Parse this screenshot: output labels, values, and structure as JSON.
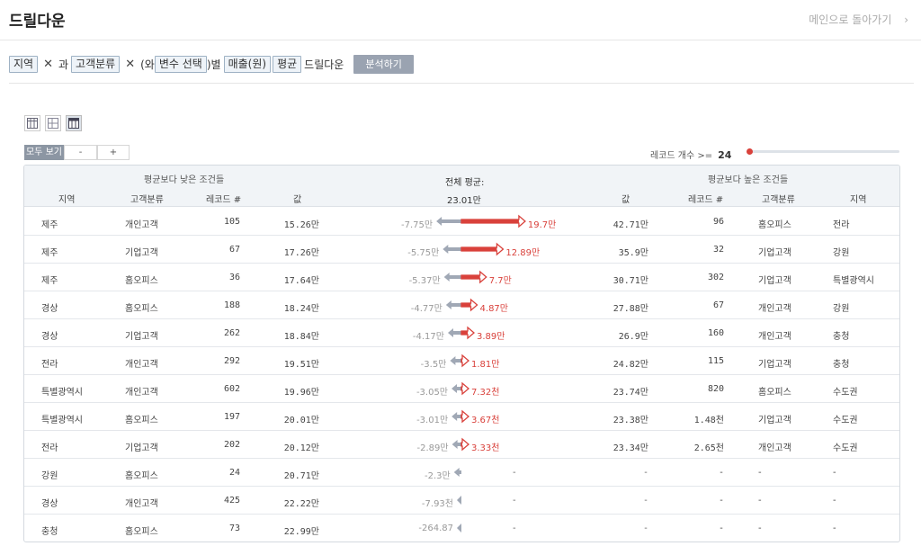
{
  "header": {
    "title": "드릴다운",
    "back_label": "메인으로 돌아가기"
  },
  "query": {
    "tag1": "지역",
    "join1": "과",
    "tag2": "고객분류",
    "open_paren": "(와",
    "tag3": "변수 선택",
    "byword": ")별",
    "tag4": "매출(원)",
    "tag5": "평균",
    "tail": "드릴다운",
    "analyze": "분석하기"
  },
  "toolbar": {
    "all": "모두 보기",
    "minus": "-",
    "plus": "+"
  },
  "record_filter": {
    "label": "레코드 개수 >=",
    "value": "24"
  },
  "table": {
    "left_group": "평균보다 낮은 조건들",
    "right_group": "평균보다 높은 조건들",
    "center_title": "전체 평균:",
    "center_value": "23.01만",
    "col_region": "지역",
    "col_segment": "고객분류",
    "col_records": "레코드 #",
    "col_value": "값",
    "rows": [
      {
        "lr": "제주",
        "ls": "개인고객",
        "lc": "105",
        "lv": "15.26만",
        "nl": "-7.75만",
        "nd": 7.75,
        "pl": "19.7만",
        "pd": 19.7,
        "rv": "42.71만",
        "rc": "96",
        "rs": "홈오피스",
        "rr": "전라"
      },
      {
        "lr": "제주",
        "ls": "기업고객",
        "lc": "67",
        "lv": "17.26만",
        "nl": "-5.75만",
        "nd": 5.75,
        "pl": "12.89만",
        "pd": 12.89,
        "rv": "35.9만",
        "rc": "32",
        "rs": "기업고객",
        "rr": "강원"
      },
      {
        "lr": "제주",
        "ls": "홈오피스",
        "lc": "36",
        "lv": "17.64만",
        "nl": "-5.37만",
        "nd": 5.37,
        "pl": "7.7만",
        "pd": 7.7,
        "rv": "30.71만",
        "rc": "302",
        "rs": "기업고객",
        "rr": "특별광역시"
      },
      {
        "lr": "경상",
        "ls": "홈오피스",
        "lc": "188",
        "lv": "18.24만",
        "nl": "-4.77만",
        "nd": 4.77,
        "pl": "4.87만",
        "pd": 4.87,
        "rv": "27.88만",
        "rc": "67",
        "rs": "개인고객",
        "rr": "강원"
      },
      {
        "lr": "경상",
        "ls": "기업고객",
        "lc": "262",
        "lv": "18.84만",
        "nl": "-4.17만",
        "nd": 4.17,
        "pl": "3.89만",
        "pd": 3.89,
        "rv": "26.9만",
        "rc": "160",
        "rs": "개인고객",
        "rr": "충청"
      },
      {
        "lr": "전라",
        "ls": "개인고객",
        "lc": "292",
        "lv": "19.51만",
        "nl": "-3.5만",
        "nd": 3.5,
        "pl": "1.81만",
        "pd": 1.81,
        "rv": "24.82만",
        "rc": "115",
        "rs": "기업고객",
        "rr": "충청"
      },
      {
        "lr": "특별광역시",
        "ls": "개인고객",
        "lc": "602",
        "lv": "19.96만",
        "nl": "-3.05만",
        "nd": 3.05,
        "pl": "7.32천",
        "pd": 0.732,
        "rv": "23.74만",
        "rc": "820",
        "rs": "홈오피스",
        "rr": "수도권"
      },
      {
        "lr": "특별광역시",
        "ls": "홈오피스",
        "lc": "197",
        "lv": "20.01만",
        "nl": "-3.01만",
        "nd": 3.01,
        "pl": "3.67천",
        "pd": 0.367,
        "rv": "23.38만",
        "rc": "1.48천",
        "rs": "기업고객",
        "rr": "수도권"
      },
      {
        "lr": "전라",
        "ls": "기업고객",
        "lc": "202",
        "lv": "20.12만",
        "nl": "-2.89만",
        "nd": 2.89,
        "pl": "3.33천",
        "pd": 0.333,
        "rv": "23.34만",
        "rc": "2.65천",
        "rs": "개인고객",
        "rr": "수도권"
      },
      {
        "lr": "강원",
        "ls": "홈오피스",
        "lc": "24",
        "lv": "20.71만",
        "nl": "-2.3만",
        "nd": 2.3,
        "pl": "-",
        "pd": 0,
        "rv": "-",
        "rc": "-",
        "rs": "-",
        "rr": "-"
      },
      {
        "lr": "경상",
        "ls": "개인고객",
        "lc": "425",
        "lv": "22.22만",
        "nl": "-7.93천",
        "nd": 0.793,
        "pl": "-",
        "pd": 0,
        "rv": "-",
        "rc": "-",
        "rs": "-",
        "rr": "-"
      },
      {
        "lr": "충청",
        "ls": "홈오피스",
        "lc": "73",
        "lv": "22.99만",
        "nl": "-264.87",
        "nd": 0.0265,
        "pl": "-",
        "pd": 0,
        "rv": "-",
        "rc": "-",
        "rs": "-",
        "rr": "-"
      }
    ]
  },
  "colors": {
    "negative": "#a0a8b5",
    "positive": "#d9413b",
    "button": "#9aa3b1"
  },
  "icons": [
    "table-view-icon",
    "split-view-icon",
    "drilldown-view-icon",
    "chevron-right-icon"
  ]
}
